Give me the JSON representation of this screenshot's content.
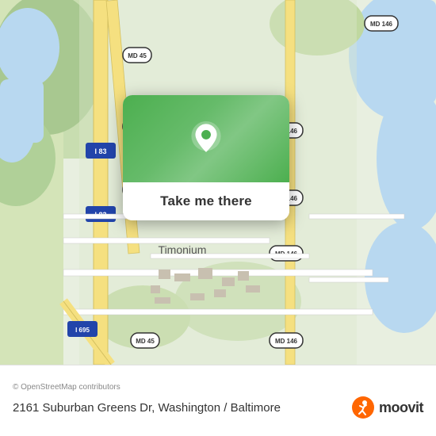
{
  "map": {
    "attribution": "© OpenStreetMap contributors",
    "center_label": "Timonium"
  },
  "popup": {
    "button_label": "Take me there"
  },
  "footer": {
    "address": "2161 Suburban Greens Dr, Washington / Baltimore",
    "logo_text": "moovit"
  },
  "icons": {
    "pin": "location-pin-icon",
    "moovit": "moovit-logo-icon"
  },
  "colors": {
    "map_green": "#b8d8a0",
    "road_yellow": "#f5e6a3",
    "popup_green": "#4caf50",
    "road_white": "#ffffff",
    "water_blue": "#a8d4f0"
  }
}
